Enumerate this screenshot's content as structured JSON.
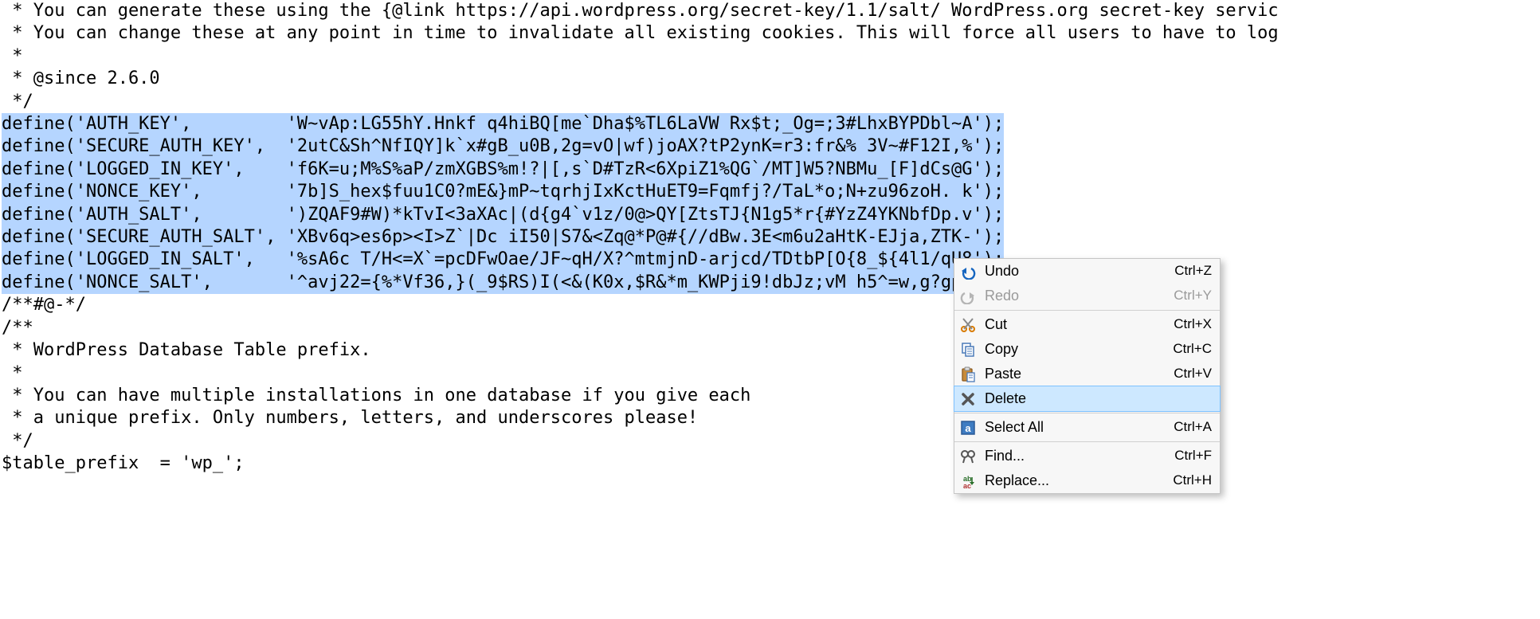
{
  "code": {
    "lines": [
      " * You can generate these using the {@link https://api.wordpress.org/secret-key/1.1/salt/ WordPress.org secret-key servic",
      " * You can change these at any point in time to invalidate all existing cookies. This will force all users to have to log",
      " *",
      " * @since 2.6.0",
      " */",
      "define('AUTH_KEY',         'W~vAp:LG55hY.Hnkf q4hiBQ[me`Dha$%TL6LaVW Rx$t;_Og=;3#LhxBYPDbl~A');",
      "define('SECURE_AUTH_KEY',  '2utC&Sh^NfIQY]k`x#gB_u0B,2g=vO|wf)joAX?tP2ynK=r3:fr&% 3V~#F12I,%');",
      "define('LOGGED_IN_KEY',    'f6K=u;M%S%aP/zmXGBS%m!?|[,s`D#TzR<6XpiZ1%QG`/MT]W5?NBMu_[F]dCs@G');",
      "define('NONCE_KEY',        '7b]S_hex$fuu1C0?mE&}mP~tqrhjIxKctHuET9=Fqmfj?/TaL*o;N+zu96zoH. k');",
      "define('AUTH_SALT',        ')ZQAF9#W)*kTvI<3aXAc|(d{g4`v1z/0@>QY[ZtsTJ{N1g5*r{#YzZ4YKNbfDp.v');",
      "define('SECURE_AUTH_SALT', 'XBv6q>es6p><I>Z`|Dc iI50|S7&<Zq@*P@#{//dBw.3E<m6u2aHtK-EJja,ZTK-');",
      "define('LOGGED_IN_SALT',   '%sA6c T/H<=X`=pcDFwOae/JF~qH/X?^mtmjnD-arjcd/TDtbP[O{8_${4l1/qU8');",
      "define('NONCE_SALT',       '^avj22={%*Vf36,}(_9$RS)I(<&(K0x,$R&*m_KWPji9!dbJz;vM h5^=w,g?gp,'",
      "",
      "/**#@-*/",
      "",
      "/**",
      " * WordPress Database Table prefix.",
      " *",
      " * You can have multiple installations in one database if you give each",
      " * a unique prefix. Only numbers, letters, and underscores please!",
      " */",
      "$table_prefix  = 'wp_';"
    ],
    "selected_start": 5,
    "selected_end": 12
  },
  "context_menu": {
    "items": [
      {
        "label": "Undo",
        "shortcut": "Ctrl+Z",
        "icon": "undo",
        "enabled": true
      },
      {
        "label": "Redo",
        "shortcut": "Ctrl+Y",
        "icon": "redo",
        "enabled": false
      },
      {
        "label": "Cut",
        "shortcut": "Ctrl+X",
        "icon": "cut",
        "enabled": true
      },
      {
        "label": "Copy",
        "shortcut": "Ctrl+C",
        "icon": "copy",
        "enabled": true
      },
      {
        "label": "Paste",
        "shortcut": "Ctrl+V",
        "icon": "paste",
        "enabled": true
      },
      {
        "label": "Delete",
        "shortcut": "",
        "icon": "delete",
        "enabled": true,
        "hover": true
      },
      {
        "label": "Select All",
        "shortcut": "Ctrl+A",
        "icon": "selectall",
        "enabled": true
      },
      {
        "label": "Find...",
        "shortcut": "Ctrl+F",
        "icon": "find",
        "enabled": true
      },
      {
        "label": "Replace...",
        "shortcut": "Ctrl+H",
        "icon": "replace",
        "enabled": true
      }
    ],
    "separators_after": [
      1,
      5,
      6
    ]
  }
}
